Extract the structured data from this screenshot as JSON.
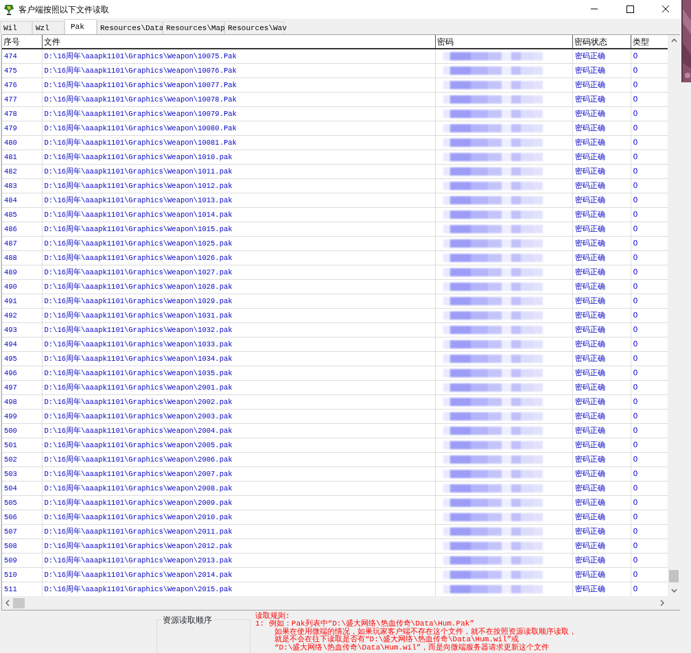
{
  "window": {
    "title": "客户端按照以下文件读取"
  },
  "tabs": [
    {
      "label": "Wil",
      "selected": false
    },
    {
      "label": "Wzl",
      "selected": false
    },
    {
      "label": "Pak",
      "selected": true
    },
    {
      "label": "Resources\\Data",
      "selected": false
    },
    {
      "label": "Resources\\Map",
      "selected": false
    },
    {
      "label": "Resources\\Wav",
      "selected": false
    }
  ],
  "table": {
    "columns": [
      "序号",
      "文件",
      "密码",
      "密码状态",
      "类型"
    ],
    "rows": [
      {
        "index": "474",
        "file": "D:\\16周年\\aaapk1101\\Graphics\\Weapon\\10075.Pak",
        "status": "密码正确",
        "type": "0"
      },
      {
        "index": "475",
        "file": "D:\\16周年\\aaapk1101\\Graphics\\Weapon\\10076.Pak",
        "status": "密码正确",
        "type": "0"
      },
      {
        "index": "476",
        "file": "D:\\16周年\\aaapk1101\\Graphics\\Weapon\\10077.Pak",
        "status": "密码正确",
        "type": "0"
      },
      {
        "index": "477",
        "file": "D:\\16周年\\aaapk1101\\Graphics\\Weapon\\10078.Pak",
        "status": "密码正确",
        "type": "0"
      },
      {
        "index": "478",
        "file": "D:\\16周年\\aaapk1101\\Graphics\\Weapon\\10079.Pak",
        "status": "密码正确",
        "type": "0"
      },
      {
        "index": "479",
        "file": "D:\\16周年\\aaapk1101\\Graphics\\Weapon\\10080.Pak",
        "status": "密码正确",
        "type": "0"
      },
      {
        "index": "480",
        "file": "D:\\16周年\\aaapk1101\\Graphics\\Weapon\\10081.Pak",
        "status": "密码正确",
        "type": "0"
      },
      {
        "index": "481",
        "file": "D:\\16周年\\aaapk1101\\Graphics\\Weapon\\1010.pak",
        "status": "密码正确",
        "type": "0"
      },
      {
        "index": "482",
        "file": "D:\\16周年\\aaapk1101\\Graphics\\Weapon\\1011.pak",
        "status": "密码正确",
        "type": "0"
      },
      {
        "index": "483",
        "file": "D:\\16周年\\aaapk1101\\Graphics\\Weapon\\1012.pak",
        "status": "密码正确",
        "type": "0"
      },
      {
        "index": "484",
        "file": "D:\\16周年\\aaapk1101\\Graphics\\Weapon\\1013.pak",
        "status": "密码正确",
        "type": "0"
      },
      {
        "index": "485",
        "file": "D:\\16周年\\aaapk1101\\Graphics\\Weapon\\1014.pak",
        "status": "密码正确",
        "type": "0"
      },
      {
        "index": "486",
        "file": "D:\\16周年\\aaapk1101\\Graphics\\Weapon\\1015.pak",
        "status": "密码正确",
        "type": "0"
      },
      {
        "index": "487",
        "file": "D:\\16周年\\aaapk1101\\Graphics\\Weapon\\1025.pak",
        "status": "密码正确",
        "type": "0"
      },
      {
        "index": "488",
        "file": "D:\\16周年\\aaapk1101\\Graphics\\Weapon\\1026.pak",
        "status": "密码正确",
        "type": "0"
      },
      {
        "index": "489",
        "file": "D:\\16周年\\aaapk1101\\Graphics\\Weapon\\1027.pak",
        "status": "密码正确",
        "type": "0"
      },
      {
        "index": "490",
        "file": "D:\\16周年\\aaapk1101\\Graphics\\Weapon\\1028.pak",
        "status": "密码正确",
        "type": "0"
      },
      {
        "index": "491",
        "file": "D:\\16周年\\aaapk1101\\Graphics\\Weapon\\1029.pak",
        "status": "密码正确",
        "type": "0"
      },
      {
        "index": "492",
        "file": "D:\\16周年\\aaapk1101\\Graphics\\Weapon\\1031.pak",
        "status": "密码正确",
        "type": "0"
      },
      {
        "index": "493",
        "file": "D:\\16周年\\aaapk1101\\Graphics\\Weapon\\1032.pak",
        "status": "密码正确",
        "type": "0"
      },
      {
        "index": "494",
        "file": "D:\\16周年\\aaapk1101\\Graphics\\Weapon\\1033.pak",
        "status": "密码正确",
        "type": "0"
      },
      {
        "index": "495",
        "file": "D:\\16周年\\aaapk1101\\Graphics\\Weapon\\1034.pak",
        "status": "密码正确",
        "type": "0"
      },
      {
        "index": "496",
        "file": "D:\\16周年\\aaapk1101\\Graphics\\Weapon\\1035.pak",
        "status": "密码正确",
        "type": "0"
      },
      {
        "index": "497",
        "file": "D:\\16周年\\aaapk1101\\Graphics\\Weapon\\2001.pak",
        "status": "密码正确",
        "type": "0"
      },
      {
        "index": "498",
        "file": "D:\\16周年\\aaapk1101\\Graphics\\Weapon\\2002.pak",
        "status": "密码正确",
        "type": "0"
      },
      {
        "index": "499",
        "file": "D:\\16周年\\aaapk1101\\Graphics\\Weapon\\2003.pak",
        "status": "密码正确",
        "type": "0"
      },
      {
        "index": "500",
        "file": "D:\\16周年\\aaapk1101\\Graphics\\Weapon\\2004.pak",
        "status": "密码正确",
        "type": "0"
      },
      {
        "index": "501",
        "file": "D:\\16周年\\aaapk1101\\Graphics\\Weapon\\2005.pak",
        "status": "密码正确",
        "type": "0"
      },
      {
        "index": "502",
        "file": "D:\\16周年\\aaapk1101\\Graphics\\Weapon\\2006.pak",
        "status": "密码正确",
        "type": "0"
      },
      {
        "index": "503",
        "file": "D:\\16周年\\aaapk1101\\Graphics\\Weapon\\2007.pak",
        "status": "密码正确",
        "type": "0"
      },
      {
        "index": "504",
        "file": "D:\\16周年\\aaapk1101\\Graphics\\Weapon\\2008.pak",
        "status": "密码正确",
        "type": "0"
      },
      {
        "index": "505",
        "file": "D:\\16周年\\aaapk1101\\Graphics\\Weapon\\2009.pak",
        "status": "密码正确",
        "type": "0"
      },
      {
        "index": "506",
        "file": "D:\\16周年\\aaapk1101\\Graphics\\Weapon\\2010.pak",
        "status": "密码正确",
        "type": "0"
      },
      {
        "index": "507",
        "file": "D:\\16周年\\aaapk1101\\Graphics\\Weapon\\2011.pak",
        "status": "密码正确",
        "type": "0"
      },
      {
        "index": "508",
        "file": "D:\\16周年\\aaapk1101\\Graphics\\Weapon\\2012.pak",
        "status": "密码正确",
        "type": "0"
      },
      {
        "index": "509",
        "file": "D:\\16周年\\aaapk1101\\Graphics\\Weapon\\2013.pak",
        "status": "密码正确",
        "type": "0"
      },
      {
        "index": "510",
        "file": "D:\\16周年\\aaapk1101\\Graphics\\Weapon\\2014.pak",
        "status": "密码正确",
        "type": "0"
      },
      {
        "index": "511",
        "file": "D:\\16周年\\aaapk1101\\Graphics\\Weapon\\2015.pak",
        "status": "密码正确",
        "type": "0"
      }
    ]
  },
  "order_group": {
    "title": "资源读取顺序"
  },
  "rules": [
    {
      "kind": "heading",
      "text": "读取规则:"
    },
    {
      "kind": "item",
      "text": "1: 例如：Pak列表中“D:\\盛大网络\\热血传奇\\Data\\Hum.Pak”"
    },
    {
      "kind": "continuation",
      "text": "如果在使用微端的情况，如果玩家客户端不存在这个文件，就不在按照资源读取顺序读取，"
    },
    {
      "kind": "continuation",
      "text": "就是不会在往下读取是否有“D:\\盛大网络\\热血传奇\\Data\\Hum.wil”或"
    },
    {
      "kind": "continuation",
      "text": "“D:\\盛大网络\\热血传奇\\Data\\Hum.wil”，而是向微端服务器请求更新这个文件"
    }
  ]
}
